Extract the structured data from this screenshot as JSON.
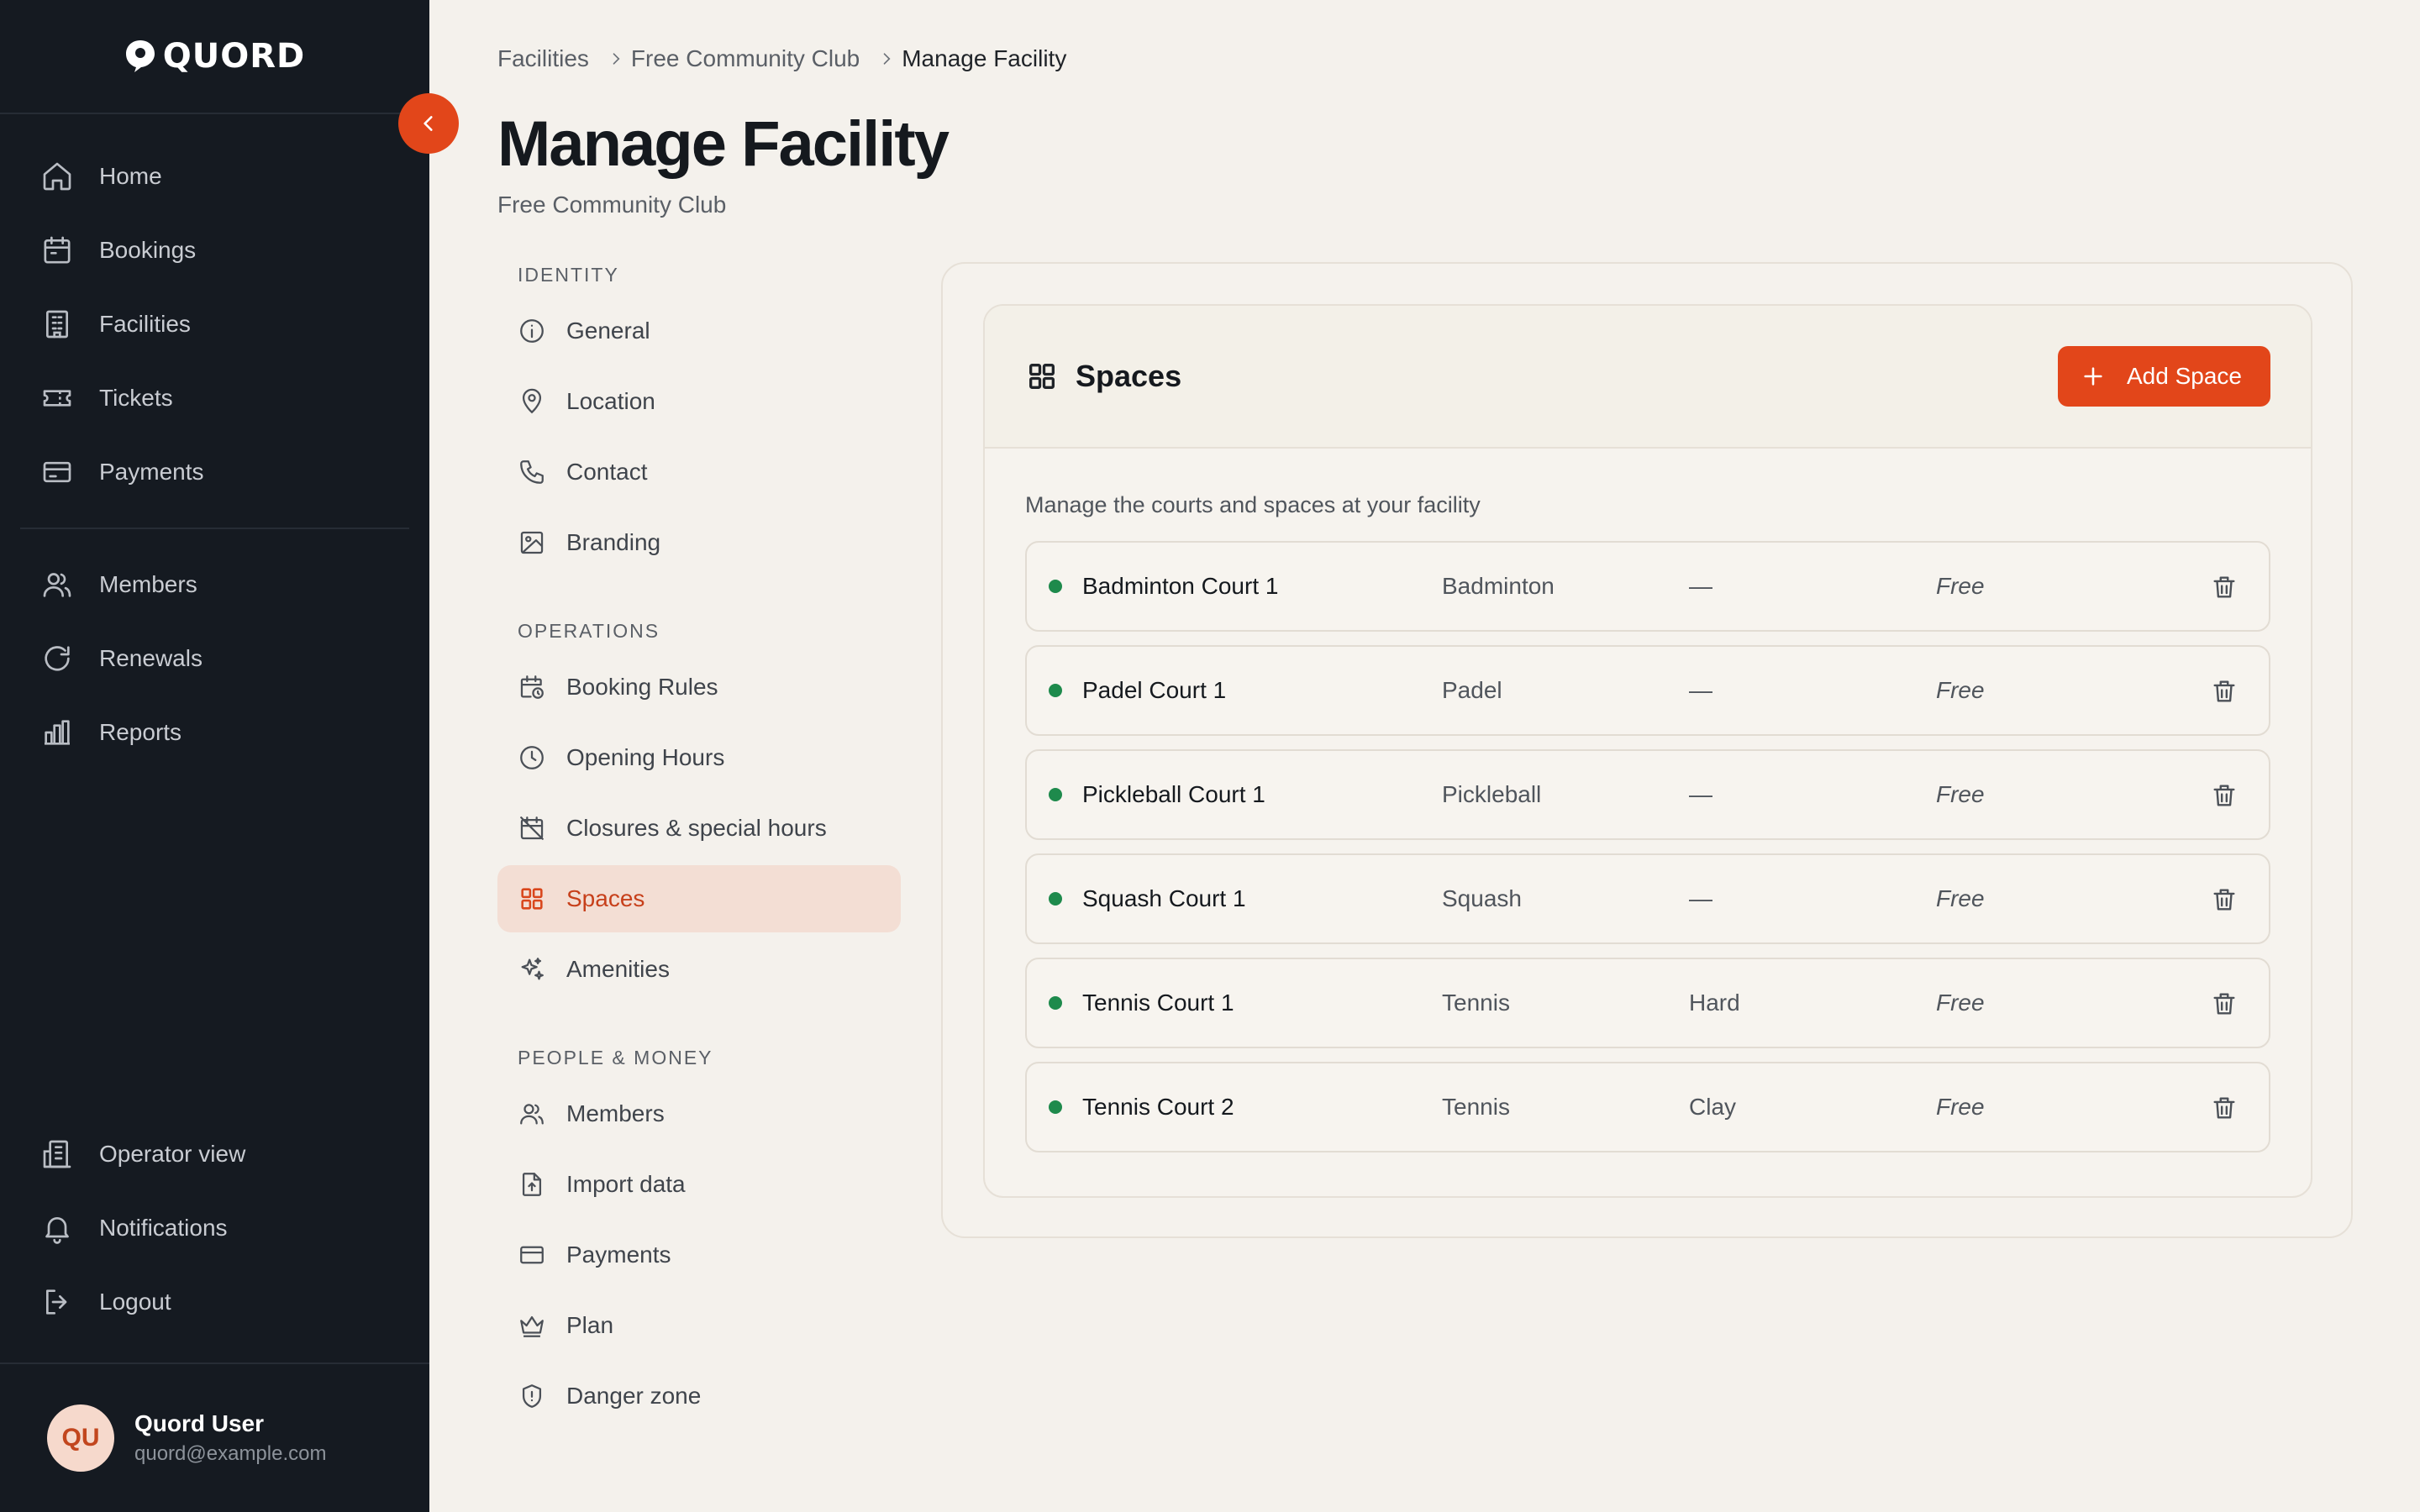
{
  "brand": {
    "name": "QUORD"
  },
  "sidebar": {
    "top_items": [
      {
        "label": "Home",
        "icon": "home-icon"
      },
      {
        "label": "Bookings",
        "icon": "calendar-icon"
      },
      {
        "label": "Facilities",
        "icon": "building-icon"
      },
      {
        "label": "Tickets",
        "icon": "ticket-icon"
      },
      {
        "label": "Payments",
        "icon": "card-icon"
      }
    ],
    "mid_items": [
      {
        "label": "Members",
        "icon": "users-icon"
      },
      {
        "label": "Renewals",
        "icon": "refresh-icon"
      },
      {
        "label": "Reports",
        "icon": "bar-chart-icon"
      }
    ],
    "bottom_items": [
      {
        "label": "Operator view",
        "icon": "building-icon"
      },
      {
        "label": "Notifications",
        "icon": "bell-icon"
      },
      {
        "label": "Logout",
        "icon": "logout-icon"
      }
    ],
    "user": {
      "initials": "QU",
      "name": "Quord User",
      "email": "quord@example.com"
    }
  },
  "breadcrumb": [
    "Facilities",
    "Free Community Club",
    "Manage Facility"
  ],
  "page": {
    "title": "Manage Facility",
    "subtitle": "Free Community Club"
  },
  "settings_menu": [
    {
      "heading": "IDENTITY",
      "items": [
        {
          "label": "General",
          "icon": "info-icon"
        },
        {
          "label": "Location",
          "icon": "map-pin-icon"
        },
        {
          "label": "Contact",
          "icon": "phone-icon"
        },
        {
          "label": "Branding",
          "icon": "image-icon"
        }
      ]
    },
    {
      "heading": "OPERATIONS",
      "items": [
        {
          "label": "Booking Rules",
          "icon": "calendar-clock-icon"
        },
        {
          "label": "Opening Hours",
          "icon": "clock-icon"
        },
        {
          "label": "Closures & special hours",
          "icon": "calendar-off-icon"
        },
        {
          "label": "Spaces",
          "icon": "grid-icon",
          "active": true
        },
        {
          "label": "Amenities",
          "icon": "sparkles-icon"
        }
      ]
    },
    {
      "heading": "PEOPLE & MONEY",
      "items": [
        {
          "label": "Members",
          "icon": "users-icon"
        },
        {
          "label": "Import data",
          "icon": "file-import-icon"
        },
        {
          "label": "Payments",
          "icon": "card-icon"
        },
        {
          "label": "Plan",
          "icon": "crown-icon"
        },
        {
          "label": "Danger zone",
          "icon": "shield-alert-icon"
        }
      ]
    }
  ],
  "spaces": {
    "title": "Spaces",
    "add_label": "Add Space",
    "description": "Manage the courts and spaces at your facility",
    "status_color": "#1e8a4c",
    "accent_color": "#e2461a",
    "rows": [
      {
        "name": "Badminton Court 1",
        "sport": "Badminton",
        "surface": "—",
        "price": "Free"
      },
      {
        "name": "Padel Court 1",
        "sport": "Padel",
        "surface": "—",
        "price": "Free"
      },
      {
        "name": "Pickleball Court 1",
        "sport": "Pickleball",
        "surface": "—",
        "price": "Free"
      },
      {
        "name": "Squash Court 1",
        "sport": "Squash",
        "surface": "—",
        "price": "Free"
      },
      {
        "name": "Tennis Court 1",
        "sport": "Tennis",
        "surface": "Hard",
        "price": "Free"
      },
      {
        "name": "Tennis Court 2",
        "sport": "Tennis",
        "surface": "Clay",
        "price": "Free"
      }
    ]
  }
}
